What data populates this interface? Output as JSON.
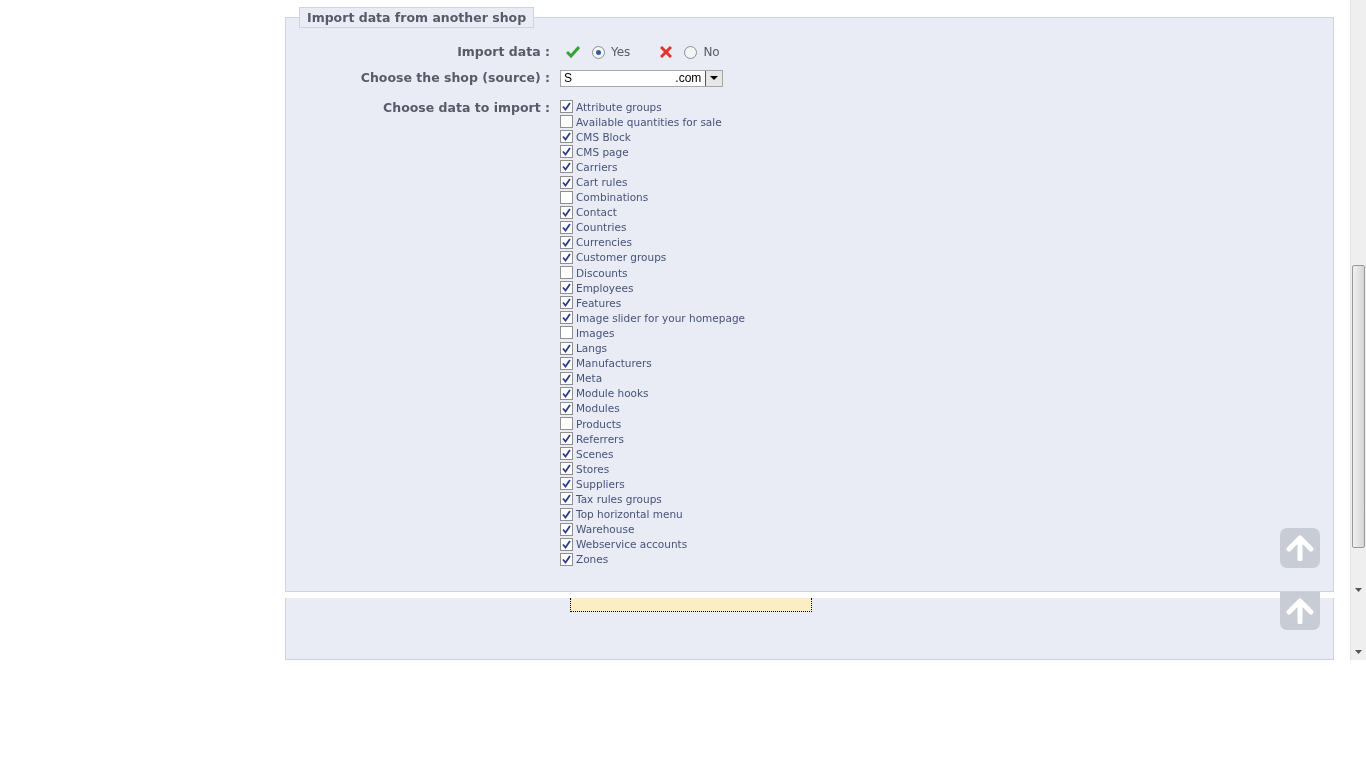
{
  "fieldset": {
    "legend": "Import data from another shop",
    "import_data": {
      "label": "Import data :",
      "options": [
        {
          "label": "Yes",
          "selected": true
        },
        {
          "label": "No",
          "selected": false
        }
      ]
    },
    "shop_source": {
      "label": "Choose the shop (source) :",
      "value": "S .com"
    },
    "data_to_import": {
      "label": "Choose data to import :",
      "items": [
        {
          "label": "Attribute groups",
          "checked": true
        },
        {
          "label": "Available quantities for sale",
          "checked": false
        },
        {
          "label": "CMS Block",
          "checked": true
        },
        {
          "label": "CMS page",
          "checked": true
        },
        {
          "label": "Carriers",
          "checked": true
        },
        {
          "label": "Cart rules",
          "checked": true
        },
        {
          "label": "Combinations",
          "checked": false
        },
        {
          "label": "Contact",
          "checked": true
        },
        {
          "label": "Countries",
          "checked": true
        },
        {
          "label": "Currencies",
          "checked": true
        },
        {
          "label": "Customer groups",
          "checked": true
        },
        {
          "label": "Discounts",
          "checked": false
        },
        {
          "label": "Employees",
          "checked": true
        },
        {
          "label": "Features",
          "checked": true
        },
        {
          "label": "Image slider for your homepage",
          "checked": true
        },
        {
          "label": "Images",
          "checked": false
        },
        {
          "label": "Langs",
          "checked": true
        },
        {
          "label": "Manufacturers",
          "checked": true
        },
        {
          "label": "Meta",
          "checked": true
        },
        {
          "label": "Module hooks",
          "checked": true
        },
        {
          "label": "Modules",
          "checked": true
        },
        {
          "label": "Products",
          "checked": false
        },
        {
          "label": "Referrers",
          "checked": true
        },
        {
          "label": "Scenes",
          "checked": true
        },
        {
          "label": "Stores",
          "checked": true
        },
        {
          "label": "Suppliers",
          "checked": true
        },
        {
          "label": "Tax rules groups",
          "checked": true
        },
        {
          "label": "Top horizontal menu",
          "checked": true
        },
        {
          "label": "Warehouse",
          "checked": true
        },
        {
          "label": "Webservice accounts",
          "checked": true
        },
        {
          "label": "Zones",
          "checked": true
        }
      ]
    }
  }
}
